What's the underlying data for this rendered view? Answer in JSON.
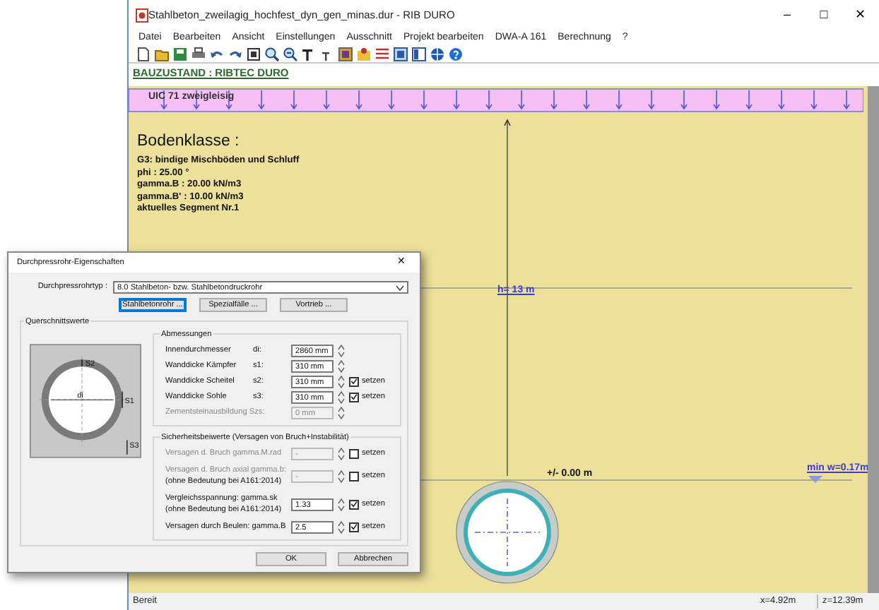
{
  "window": {
    "title": "Stahlbeton_zweilagig_hochfest_dyn_gen_minas.dur - RIB DURO",
    "controls": [
      "–",
      "□",
      "✕"
    ]
  },
  "menu": [
    "Datei",
    "Bearbeiten",
    "Ansicht",
    "Einstellungen",
    "Ausschnitt",
    "Projekt bearbeiten",
    "DWA-A 161",
    "Berechnung",
    "?"
  ],
  "header": "BAUZUSTAND : RIBTEC DURO",
  "canvas": {
    "load_label": "UIC 71 zweigleisig",
    "soil_title": "Bodenklasse :",
    "soil_lines": [
      "G3: bindige Mischböden und Schluff",
      "phi : 25.00 °",
      "gamma.B : 20.00 kN/m3",
      "gamma.B' : 10.00 kN/m3",
      "aktuelles Segment Nr.1"
    ],
    "depth_label": "h= 13 m",
    "level_label": "+/- 0.00 m",
    "water_label": "min w=0.17m"
  },
  "dialog": {
    "title": "Durchpressrohr-Eigenschaften",
    "close": "✕",
    "type_label": "Durchpressrohrtyp :",
    "type_value": "8.0 Stahlbeton- bzw. Stahlbetondruckrohr",
    "buttons": [
      {
        "label": "Stahlbetonrohr ...",
        "selected": true
      },
      {
        "label": "Spezialfälle ...",
        "selected": false
      },
      {
        "label": "Vortrieb ...",
        "selected": false
      }
    ],
    "section_label": "Querschnittswerte",
    "diagram_labels": [
      "S2",
      "di",
      "S1",
      "S3"
    ],
    "dimensions": {
      "title": "Abmessungen",
      "rows": [
        {
          "label": "Innendurchmesser",
          "symbol": "di:",
          "value": "2860 mm",
          "disabled": false
        },
        {
          "label": "Wanddicke Kämpfer",
          "symbol": "s1:",
          "value": "310 mm",
          "disabled": false
        },
        {
          "label": "Wanddicke Scheitel",
          "symbol": "s2:",
          "value": "310 mm",
          "disabled": false,
          "check_label": "setzen",
          "checked": true
        },
        {
          "label": "Wanddicke Sohle",
          "symbol": "s3:",
          "value": "310 mm",
          "disabled": false,
          "check_label": "setzen",
          "checked": true
        },
        {
          "label": "Zementsteinausbildung Szs:",
          "value": "0 mm",
          "disabled": true
        }
      ]
    },
    "safety": {
      "title": "Sicherheitsbeiwerte (Versagen von Bruch+Instabilität)",
      "rows": [
        {
          "label": "Versagen d. Bruch gamma.M.rad",
          "value": "-",
          "disabled": true,
          "check_label": "setzen",
          "checked": false
        },
        {
          "label": "Versagen d. Bruch axial gamma.b:",
          "note": "(ohne Bedeutung bei A161:2014)",
          "value": "-",
          "disabled": true,
          "check_label": "setzen",
          "checked": false
        },
        {
          "label": "Vergleichsspannung: gamma.sk",
          "note": "(ohne Bedeutung bei A161:2014)",
          "value": "1.33",
          "disabled": false,
          "check_label": "setzen",
          "checked": true
        },
        {
          "label": "Versagen durch Beulen: gamma.B",
          "value": "2.5",
          "disabled": false,
          "check_label": "setzen",
          "checked": true
        }
      ]
    },
    "actions": [
      "OK",
      "Abbrechen"
    ]
  },
  "status_bar": {
    "text": "Bereit",
    "x": "x=4.92m",
    "z": "z=12.39m"
  }
}
